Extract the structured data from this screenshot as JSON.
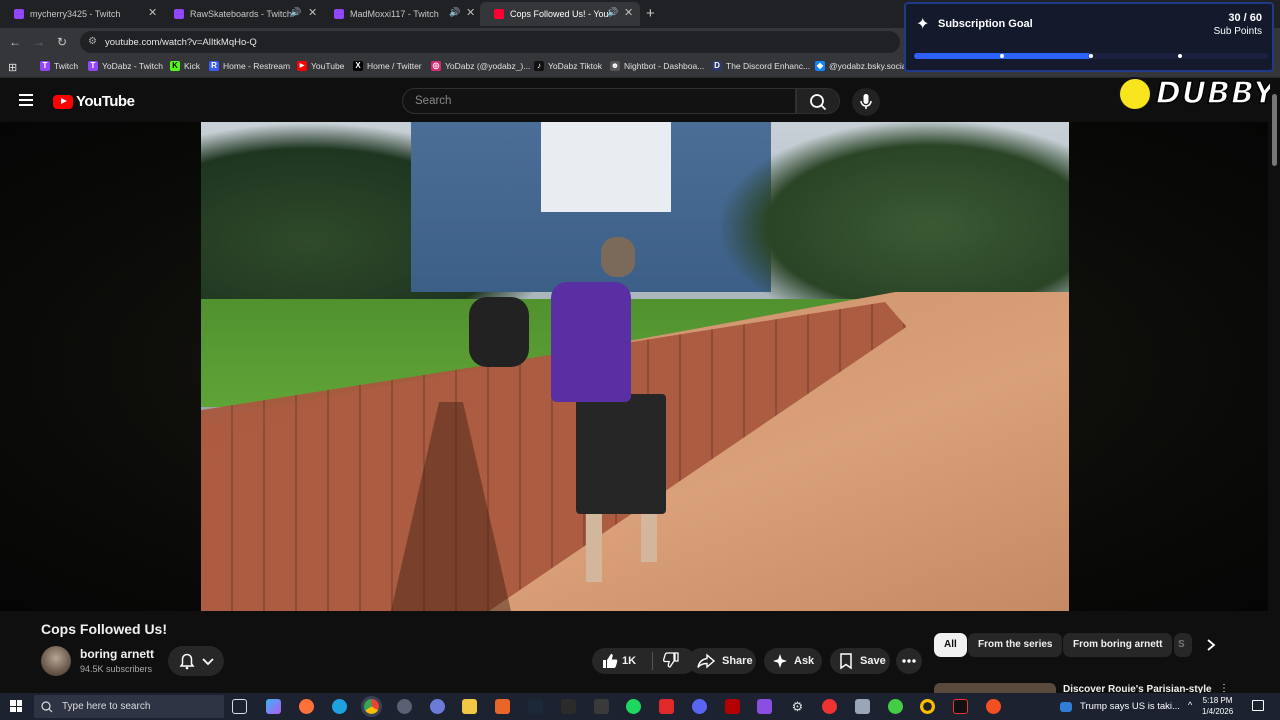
{
  "browser": {
    "tabs": [
      {
        "title": "mycherry3425 - Twitch",
        "favicon_color": "#9146ff",
        "audio": false,
        "active": false
      },
      {
        "title": "RawSkateboards - Twitch",
        "favicon_color": "#9146ff",
        "audio": true,
        "active": false
      },
      {
        "title": "MadMoxxi117 - Twitch",
        "favicon_color": "#9146ff",
        "audio": true,
        "active": false
      },
      {
        "title": "Cops Followed Us! - YouTu",
        "favicon_color": "#ff0033",
        "audio": true,
        "active": true
      }
    ],
    "new_tab_icon": "plus-icon",
    "url": "youtube.com/watch?v=AlItkMqHo-Q",
    "bookmarks": [
      {
        "label": "Twitch",
        "icon": "T",
        "color": "#9146ff"
      },
      {
        "label": "YoDabz - Twitch",
        "icon": "T",
        "color": "#9146ff"
      },
      {
        "label": "Kick",
        "icon": "K",
        "color": "#53fc18"
      },
      {
        "label": "Home - Restream",
        "icon": "R",
        "color": "#3a5cff"
      },
      {
        "label": "YouTube",
        "icon": "▶",
        "color": "#ff0000"
      },
      {
        "label": "Home / Twitter",
        "icon": "X",
        "color": "#000000"
      },
      {
        "label": "YoDabz (@yodabz_)...",
        "icon": "◎",
        "color": "#d62976"
      },
      {
        "label": "YoDabz Tiktok",
        "icon": "♪",
        "color": "#111111"
      },
      {
        "label": "Nightbot - Dashboa...",
        "icon": "☻",
        "color": "#555555"
      },
      {
        "label": "The Discord Enhanc...",
        "icon": "D",
        "color": "#2b3a67"
      },
      {
        "label": "@yodabz.bsky.socia...",
        "icon": "◆",
        "color": "#1185fe"
      }
    ]
  },
  "overlay": {
    "goal_title": "Subscription Goal",
    "goal_count": "30 / 60",
    "goal_unit": "Sub Points",
    "goal_progress": 0.5,
    "accent": "#2962ff",
    "logo_text": "DUBBY"
  },
  "youtube": {
    "logo_text": "YouTube",
    "search_placeholder": "Search",
    "video_title": "Cops Followed Us!",
    "channel_name": "boring arnett",
    "subscribers": "94.5K subscribers",
    "like_count": "1K",
    "share_label": "Share",
    "ask_label": "Ask",
    "save_label": "Save",
    "chips": [
      "All",
      "From the series",
      "From boring arnett",
      "S"
    ],
    "recommended_title": "Discover Rouie's Parisian-style"
  },
  "taskbar": {
    "search_placeholder": "Type here to search",
    "news_text": "Trump says US is taki...",
    "time": "5:18 PM",
    "date": "1/4/2026"
  }
}
